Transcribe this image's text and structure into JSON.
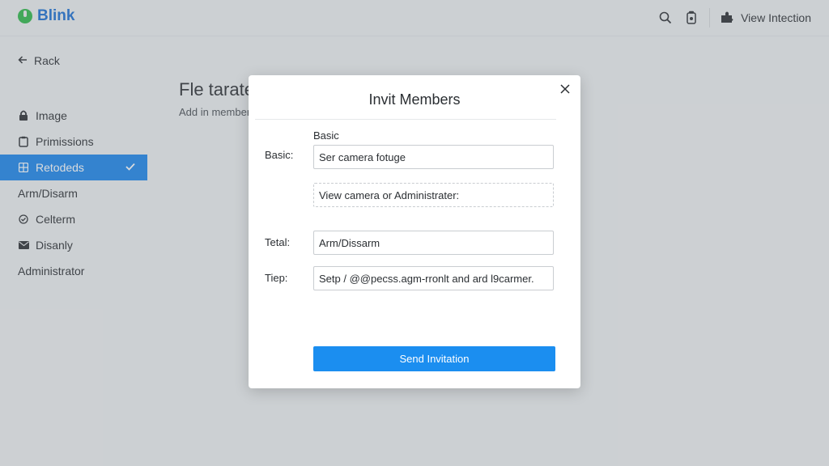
{
  "app": {
    "name": "Blink"
  },
  "topbar": {
    "view_link": "View Intection"
  },
  "sidebar": {
    "back": "Rack",
    "items": [
      {
        "label": "Image",
        "icon": "lock-icon"
      },
      {
        "label": "Primissions",
        "icon": "clipboard-icon"
      },
      {
        "label": "Retodeds",
        "icon": "grid-icon",
        "active": true
      },
      {
        "label": "Arm/Disarm"
      },
      {
        "label": "Celterm",
        "icon": "circle-check-icon"
      },
      {
        "label": "Disanly",
        "icon": "mail-icon"
      },
      {
        "label": "Administrator"
      }
    ]
  },
  "main": {
    "title": "Fle tarate",
    "subtitle": "Add in member"
  },
  "modal": {
    "title": "Invit Members",
    "section_label": "Basic",
    "rows": [
      {
        "label": "Basic:",
        "value": "Ser camera fotuge"
      },
      {
        "label": "",
        "value": "View camera or Administrater:"
      },
      {
        "label": "Tetal:",
        "value": "Arm/Dissarm"
      },
      {
        "label": "Tiep:",
        "value": "Setp / @@pecss.agm-rronlt and ard l9carmer."
      }
    ],
    "submit": "Send Invitation"
  },
  "colors": {
    "accent": "#1b86ec",
    "brand": "#1b6fd3",
    "logo": "#2fb94a",
    "button": "#1b8ef0"
  }
}
